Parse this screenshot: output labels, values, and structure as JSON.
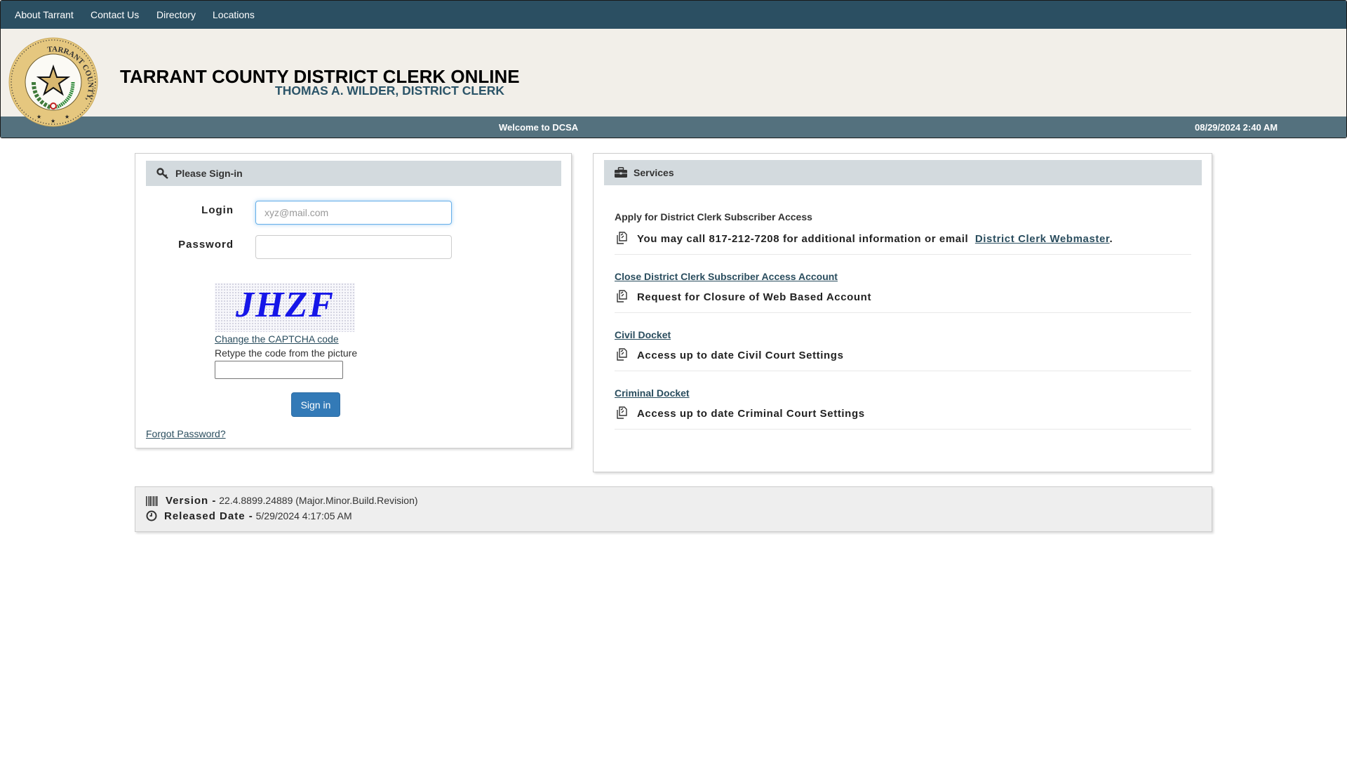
{
  "topnav": {
    "items": [
      {
        "label": "About Tarrant"
      },
      {
        "label": "Contact Us"
      },
      {
        "label": "Directory"
      },
      {
        "label": "Locations"
      }
    ]
  },
  "header": {
    "seal_alt": "Tarrant County, Texas seal",
    "seal_text": "TARRANT COUNTY, TEXAS",
    "title": "TARRANT COUNTY DISTRICT CLERK ONLINE",
    "subtitle": "THOMAS A. WILDER, DISTRICT CLERK",
    "welcome": "Welcome to DCSA",
    "datetime": "08/29/2024 2:40 AM"
  },
  "signin": {
    "heading": "Please Sign-in",
    "heading_icon": "key-icon",
    "login_label": "Login",
    "login_placeholder": "xyz@mail.com",
    "login_value": "",
    "password_label": "Password",
    "password_value": "",
    "captcha_code": "JHZF",
    "captcha_change_label": "Change the CAPTCHA code",
    "captcha_hint": "Retype the code from the picture",
    "captcha_value": "",
    "submit_label": "Sign in",
    "forgot_label": "Forgot Password?"
  },
  "services": {
    "heading": "Services",
    "heading_icon": "briefcase-icon",
    "items": [
      {
        "title": "Apply for District Clerk Subscriber Access",
        "is_link": false,
        "description": "You may call 817-212-7208 for additional information or email",
        "link_label": "District Clerk Webmaster",
        "suffix": ".",
        "icon": "copy-icon"
      },
      {
        "title": "Close District Clerk Subscriber Access Account",
        "is_link": true,
        "description": "Request for Closure of Web Based Account",
        "icon": "copy-icon"
      },
      {
        "title": "Civil Docket",
        "is_link": true,
        "description": "Access up to date Civil Court Settings",
        "icon": "copy-icon"
      },
      {
        "title": "Criminal Docket",
        "is_link": true,
        "description": "Access up to date Criminal Court Settings",
        "icon": "copy-icon"
      }
    ]
  },
  "footer": {
    "version_label": "Version -",
    "version_value": "22.4.8899.24889 (Major.Minor.Build.Revision)",
    "released_label": "Released Date -",
    "released_value": "5/29/2024 4:17:05 AM"
  },
  "colors": {
    "nav_bg": "#2b4f62",
    "banner_bg": "#f2efe9",
    "welcome_bar_bg": "#54717e",
    "panel_head_bg": "#d3dade",
    "primary_button": "#337ab7",
    "link": "#2a4d5e"
  }
}
